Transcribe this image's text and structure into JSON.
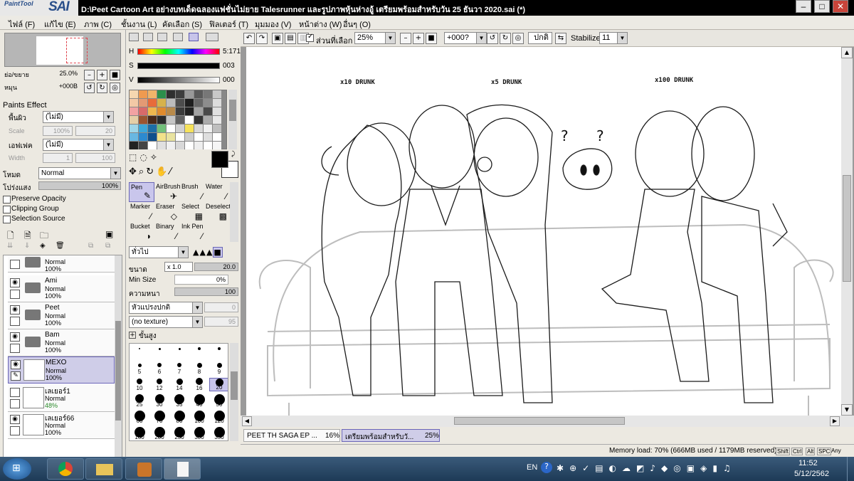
{
  "window": {
    "logo_small": "PaintTool",
    "logo_big": "SAI",
    "title": "D:\\Peet Cartoon Art อย่างบทเด็ดฉลองแฟชั่นไม่ยาย Talesrunner และรูปภาพหุ้นห่างอู้ เตรียมพร้อมสำหรับวัน 25 ธันวา 2020.sai (*)",
    "min": "–",
    "max": "□",
    "close": "✕"
  },
  "menu": [
    "ไฟล์ (F)",
    "แก้ไข (E)",
    "ภาพ (C)",
    "ชั้นงาน (L)",
    "คัดเลือก (S)",
    "ฟิลเตอร์ (T)",
    "มุมมอง (V)",
    "หน้าต่าง (W)",
    "อื่นๆ (O)"
  ],
  "toolbar": {
    "selection_check_label": "ส่วนที่เลือก",
    "zoom": "25%",
    "angle": "+000?",
    "mode": "ปกติ",
    "stabilize_label": "Stabilize",
    "stabilize_value": "11"
  },
  "navigator": {
    "zoom_label": "ย่อ/ขยาย",
    "zoom_value": "25.0%",
    "rotate_label": "หมุน",
    "rotate_value": "+000B"
  },
  "paints_effect": {
    "title": "Paints Effect",
    "texture_label": "พื้นผิว",
    "texture_value": "(ไม่มี)",
    "scale_label": "Scale",
    "scale_value": "100%",
    "scale_num": "20",
    "effect_label": "เอฟเฟค",
    "effect_value": "(ไม่มี)",
    "width_label": "Width",
    "width_value": "1",
    "width_num": "100"
  },
  "layer_props": {
    "mode_label": "โหมด",
    "mode_value": "Normal",
    "opacity_label": "โปร่งแสง",
    "opacity_value": "100%",
    "preserve_opacity": "Preserve Opacity",
    "clipping_group": "Clipping Group",
    "selection_source": "Selection Source"
  },
  "layers": [
    {
      "name": "",
      "mode": "Normal",
      "opacity": "100%",
      "folder": true,
      "visible": false
    },
    {
      "name": "Ami",
      "mode": "Normal",
      "opacity": "100%",
      "folder": true,
      "visible": true
    },
    {
      "name": "Peet",
      "mode": "Normal",
      "opacity": "100%",
      "folder": true,
      "visible": true
    },
    {
      "name": "Bam",
      "mode": "Normal",
      "opacity": "100%",
      "folder": true,
      "visible": true
    },
    {
      "name": "MEXO",
      "mode": "Normal",
      "opacity": "100%",
      "folder": false,
      "visible": true,
      "selected": true
    },
    {
      "name": "เลเยอร์1",
      "mode": "Normal",
      "opacity": "48%",
      "folder": false,
      "visible": false
    },
    {
      "name": "เลเยอร์66",
      "mode": "Normal",
      "opacity": "100%",
      "folder": false,
      "visible": true
    }
  ],
  "color": {
    "h_label": "H",
    "h_value": "5:171",
    "s_label": "S",
    "s_value": "003",
    "v_label": "V",
    "v_value": "000",
    "primary": "#000000",
    "secondary": "#ffffff"
  },
  "swatches": [
    "#f5d7b0",
    "#ef9a50",
    "#f0b46a",
    "#2b8f4b",
    "#2f2f2f",
    "#3d3d3d",
    "#999999",
    "#5a5a5a",
    "#777777",
    "#c8c8c8",
    "#f3c9a6",
    "#e39a74",
    "#e86b3a",
    "#d6b24b",
    "#bcbcbc",
    "#4d4d4d",
    "#1f1f1f",
    "#676767",
    "#8d8d8d",
    "#dcdcdc",
    "#f2a2a2",
    "#d86a6a",
    "#efb74f",
    "#e08b2d",
    "#b88a4a",
    "#3c3c3c",
    "#222222",
    "#a3a3a3",
    "#4a4a4a",
    "#e0e0e0",
    "#e5cfa7",
    "#9b5530",
    "#4a2a1a",
    "#2b2b2b",
    "#c6c6c6",
    "#616161",
    "#ffffff",
    "#333333",
    "#ababab",
    "#e8e8e8",
    "#9fd6e8",
    "#3ca7d8",
    "#1d6ea6",
    "#72c07a",
    "#ffffff",
    "#d0d0d0",
    "#f6e25a",
    "#d8d8d8",
    "#f0f0f0",
    "#bfbfbf",
    "#68b7e2",
    "#2c8ad0",
    "#0f4f8c",
    "#f2e28a",
    "#e9e3a0",
    "#ffffff",
    "#cccccc",
    "#ffffff",
    "#dedede",
    "#ffffff",
    "#222222",
    "#444444",
    "#ffffff",
    "#e0e0e0",
    "#f0f0f0",
    "#d8d8d8",
    "#ffffff",
    "#eeeeee",
    "#ffffff",
    "#f5f5f5"
  ],
  "tools": [
    {
      "label": "Pen",
      "glyph": "✎",
      "selected": true
    },
    {
      "label": "AirBrush",
      "glyph": "✈"
    },
    {
      "label": "Brush",
      "glyph": "⁄"
    },
    {
      "label": "Water",
      "glyph": "⁄"
    },
    {
      "label": "Marker",
      "glyph": "⁄"
    },
    {
      "label": "Eraser",
      "glyph": "◇"
    },
    {
      "label": "Select",
      "glyph": "▦"
    },
    {
      "label": "Deselect",
      "glyph": "▩"
    },
    {
      "label": "Bucket",
      "glyph": "◗"
    },
    {
      "label": "Binary",
      "glyph": "⁄"
    },
    {
      "label": "Ink Pen",
      "glyph": "⁄"
    }
  ],
  "brush_settings": {
    "edge": "ทั่วไป",
    "size_label": "ขนาด",
    "size_mult": "x 1.0",
    "size_value": "20.0",
    "minsize_label": "Min Size",
    "minsize_value": "0%",
    "density_label": "ความหนา",
    "density_value": "100",
    "shape": "หัวแปรงปกติ",
    "shape_num": "0",
    "texture": "(no texture)",
    "texture_num": "95",
    "advanced": "ขั้นสูง"
  },
  "brush_sizes": [
    "1",
    "1.5",
    "2",
    "2.3",
    "2.6",
    "5",
    "6",
    "7",
    "8",
    "9",
    "10",
    "12",
    "14",
    "16",
    "20",
    "25",
    "30",
    "35",
    "40",
    "50",
    "60",
    "70",
    "80",
    "100",
    "120",
    "160",
    "200",
    "250",
    "300",
    "350"
  ],
  "canvas": {
    "drunk_labels": [
      "x10   DRUNK",
      "x5   DRUNK",
      "x100   DRUNK"
    ],
    "questions": [
      "?",
      "?"
    ]
  },
  "doc_tabs": [
    {
      "name": "PEET TH SAGA EP ...",
      "zoom": "16%"
    },
    {
      "name": "เตรียมพร้อมสำหรับวั...",
      "zoom": "25%",
      "active": true
    }
  ],
  "status": {
    "memory": "Memory load: 70% (666MB used / 1179MB reserved)",
    "keys": [
      "Shift",
      "Ctrl",
      "Alt",
      "SPC",
      "Any"
    ]
  },
  "taskbar": {
    "lang": "EN",
    "time": "11:52",
    "date": "5/12/2562"
  }
}
